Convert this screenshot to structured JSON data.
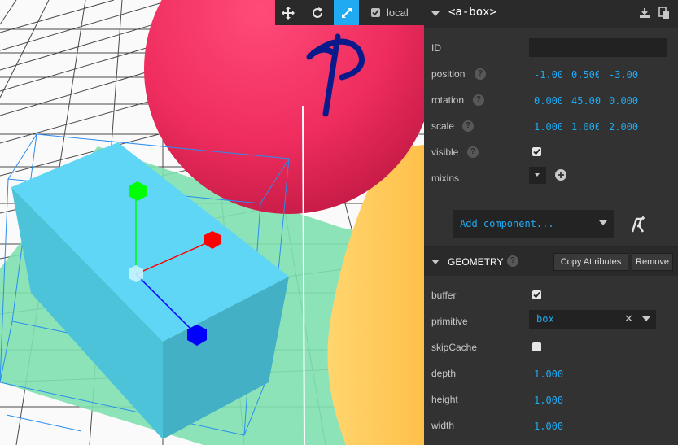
{
  "toolbar": {
    "tools": [
      "move-icon",
      "rotate-icon",
      "scale-icon"
    ],
    "active_tool": "scale-icon",
    "local_label": "local",
    "local_checked": true
  },
  "entity": {
    "title": "<a-box>",
    "actions": [
      "download-icon",
      "copy-icon"
    ]
  },
  "properties": {
    "id_label": "ID",
    "id_value": "",
    "position_label": "position",
    "position": [
      "-1.000",
      "0.500",
      "-3.000"
    ],
    "rotation_label": "rotation",
    "rotation": [
      "0.000",
      "45.000",
      "0.000"
    ],
    "scale_label": "scale",
    "scale": [
      "1.000",
      "1.000",
      "2.000"
    ],
    "visible_label": "visible",
    "visible": true,
    "mixins_label": "mixins"
  },
  "add_component": {
    "label": "Add component..."
  },
  "geometry": {
    "title": "GEOMETRY",
    "copy_label": "Copy Attributes",
    "remove_label": "Remove",
    "buffer_label": "buffer",
    "buffer": true,
    "primitive_label": "primitive",
    "primitive": "box",
    "skipcache_label": "skipCache",
    "skipcache": false,
    "depth_label": "depth",
    "depth": "1.000",
    "height_label": "height",
    "height": "1.000",
    "width_label": "width",
    "width": "1.000"
  },
  "colors": {
    "accent": "#1faaf2",
    "sphere": "#ef2d5e",
    "box": "#4cc3d9",
    "cylinder": "#ffc65d",
    "plane": "#7bc8a4",
    "gizmo_x": "#ff0000",
    "gizmo_y": "#00ff00",
    "gizmo_z": "#0000ff"
  }
}
